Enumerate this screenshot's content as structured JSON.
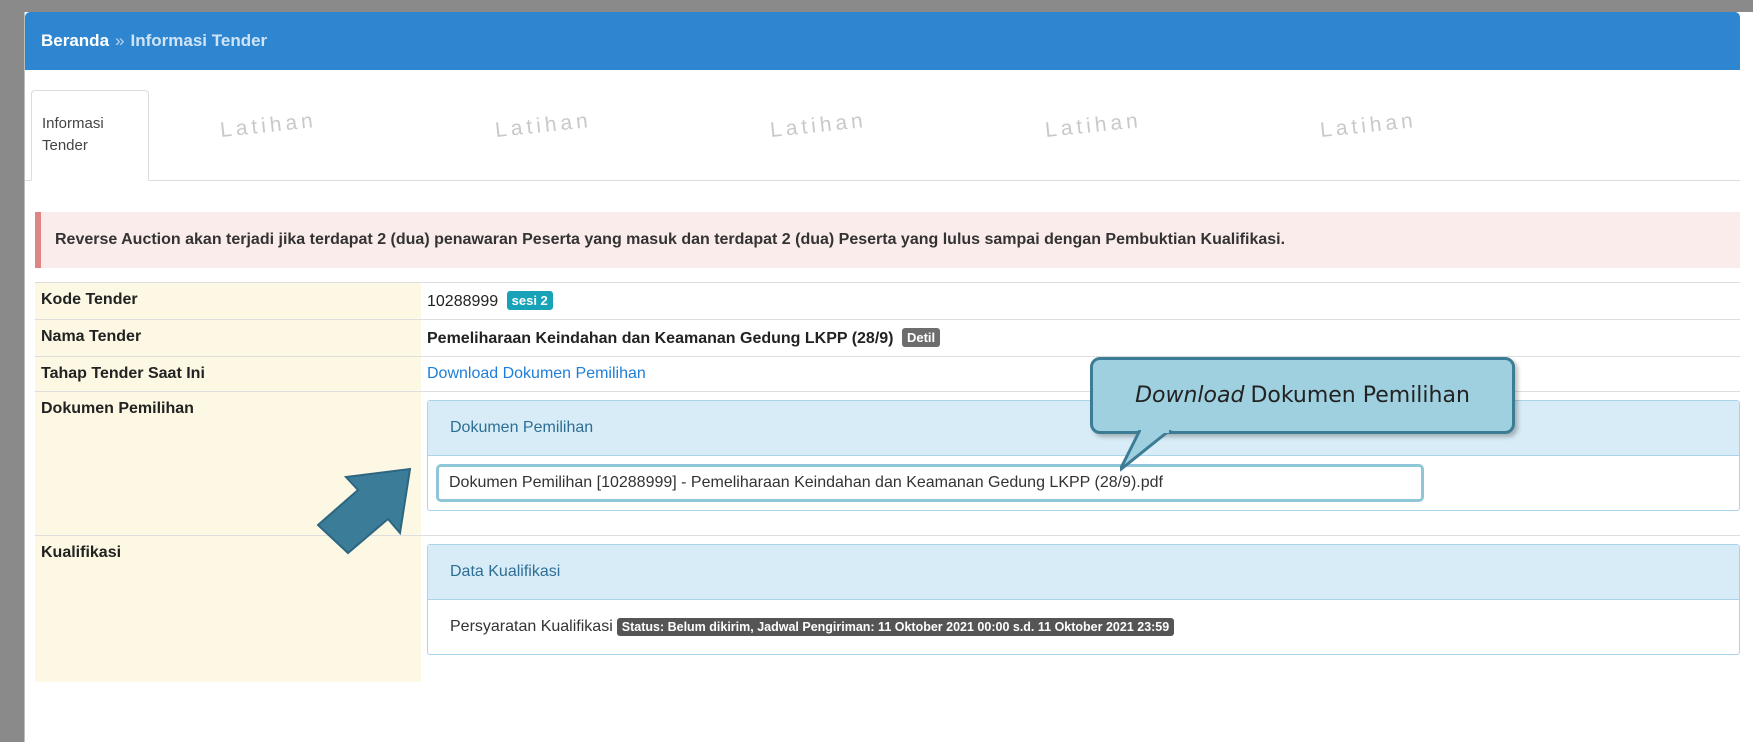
{
  "breadcrumb": {
    "home": "Beranda",
    "separator": "»",
    "current": "Informasi Tender"
  },
  "tabs": [
    {
      "label_line1": "Informasi",
      "label_line2": "Tender"
    }
  ],
  "watermark": "Latihan",
  "alert": "Reverse Auction akan terjadi jika terdapat 2 (dua) penawaran Peserta yang masuk dan terdapat 2 (dua) Peserta yang lulus sampai dengan Pembuktian Kualifikasi.",
  "rows": {
    "kode": {
      "label": "Kode Tender",
      "value": "10288999",
      "badge": "sesi 2"
    },
    "nama": {
      "label": "Nama Tender",
      "value": "Pemeliharaan Keindahan dan Keamanan Gedung LKPP (28/9)",
      "badge": "Detil"
    },
    "tahap": {
      "label": "Tahap Tender Saat Ini",
      "value": "Download Dokumen Pemilihan"
    },
    "dokumen": {
      "label": "Dokumen Pemilihan",
      "panel_title": "Dokumen Pemilihan",
      "file": "Dokumen Pemilihan [10288999] - Pemeliharaan Keindahan dan Keamanan Gedung LKPP (28/9).pdf"
    },
    "kualifikasi": {
      "label": "Kualifikasi",
      "panel_title": "Data Kualifikasi",
      "item": "Persyaratan Kualifikasi",
      "status": "Status: Belum dikirim, Jadwal Pengiriman: 11 Oktober 2021 00:00 s.d. 11 Oktober 2021 23:59"
    }
  },
  "callout": {
    "italic": "Download",
    "text": "Dokumen Pemilihan"
  },
  "colors": {
    "header": "#2f86d0",
    "label_bg": "#fcf8e3",
    "alert_bg": "#fbecec",
    "callout": "#9fd0e0",
    "arrow": "#3b7d98"
  }
}
